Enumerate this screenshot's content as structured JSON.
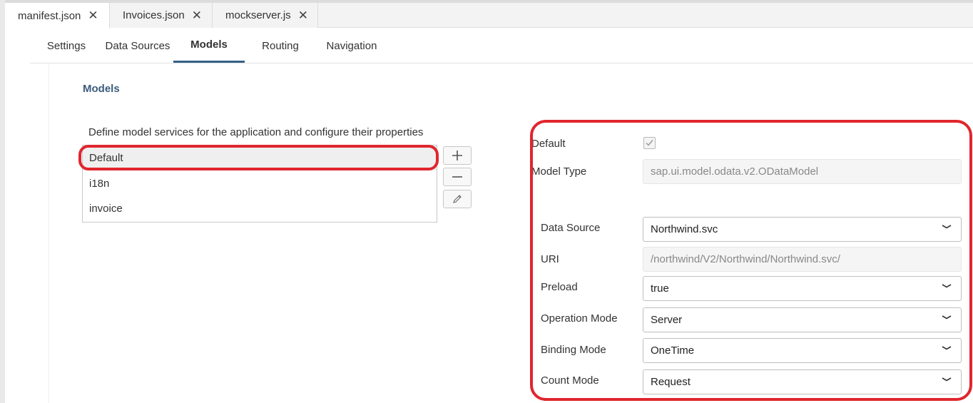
{
  "file_tabs": [
    {
      "label": "manifest.json"
    },
    {
      "label": "Invoices.json"
    },
    {
      "label": "mockserver.js"
    }
  ],
  "close_glyph": "✕",
  "editor_tabs": [
    {
      "label": "Settings"
    },
    {
      "label": "Data Sources"
    },
    {
      "label": "Models"
    },
    {
      "label": "Routing"
    },
    {
      "label": "Navigation"
    }
  ],
  "active_editor_tab": "Models",
  "section_title": "Models",
  "description": "Define model services for the application and configure their properties",
  "models": [
    {
      "label": "Default"
    },
    {
      "label": "i18n"
    },
    {
      "label": "invoice"
    }
  ],
  "selected_model": "Default",
  "list_buttons": {
    "add": "+",
    "remove": "—",
    "edit": "edit-icon"
  },
  "properties": {
    "default_label": "Default",
    "default_checked": true,
    "model_type_label": "Model Type",
    "model_type_value": "sap.ui.model.odata.v2.ODataModel",
    "data_source_label": "Data Source",
    "data_source_value": "Northwind.svc",
    "uri_label": "URI",
    "uri_value": "/northwind/V2/Northwind/Northwind.svc/",
    "preload_label": "Preload",
    "preload_value": "true",
    "operation_mode_label": "Operation Mode",
    "operation_mode_value": "Server",
    "binding_mode_label": "Binding Mode",
    "binding_mode_value": "OneTime",
    "count_mode_label": "Count Mode",
    "count_mode_value": "Request"
  },
  "colors": {
    "highlight": "#e0262e",
    "active_tab_underline": "#346187",
    "section_title": "#3b5b7d"
  }
}
